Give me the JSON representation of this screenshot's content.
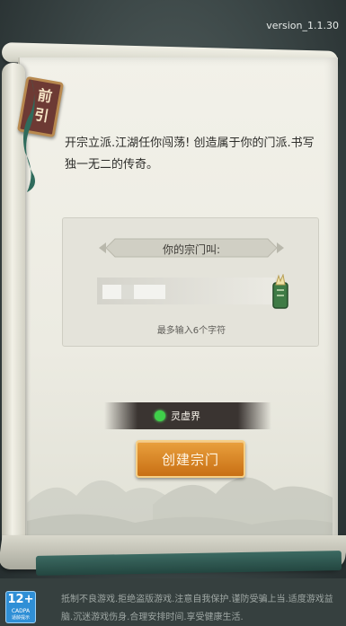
{
  "version": "version_1.1.30",
  "badge": {
    "label": "前引"
  },
  "intro": "开宗立派.江湖任你闯荡! 创造属于你的门派.书写独一无二的传奇。",
  "name_panel": {
    "title": "你的宗门叫:",
    "input_value": "",
    "max_hint": "最多输入6个字符"
  },
  "realm": {
    "label": "灵虚界",
    "status_color": "#3fd04a"
  },
  "create_button": {
    "label": "创建宗门"
  },
  "footer": {
    "age_rating": "12+",
    "age_sub": "CADPA",
    "age_sub2": "适龄提示",
    "notice": "抵制不良游戏.拒绝盗版游戏.注意自我保护.谨防受骗上当.适度游戏益脑.沉迷游戏伤身.合理安排时间.享受健康生活."
  },
  "colors": {
    "accent_orange": "#d9832a",
    "badge_red": "#6d3a34",
    "ribbon_green": "#2f5a53"
  }
}
